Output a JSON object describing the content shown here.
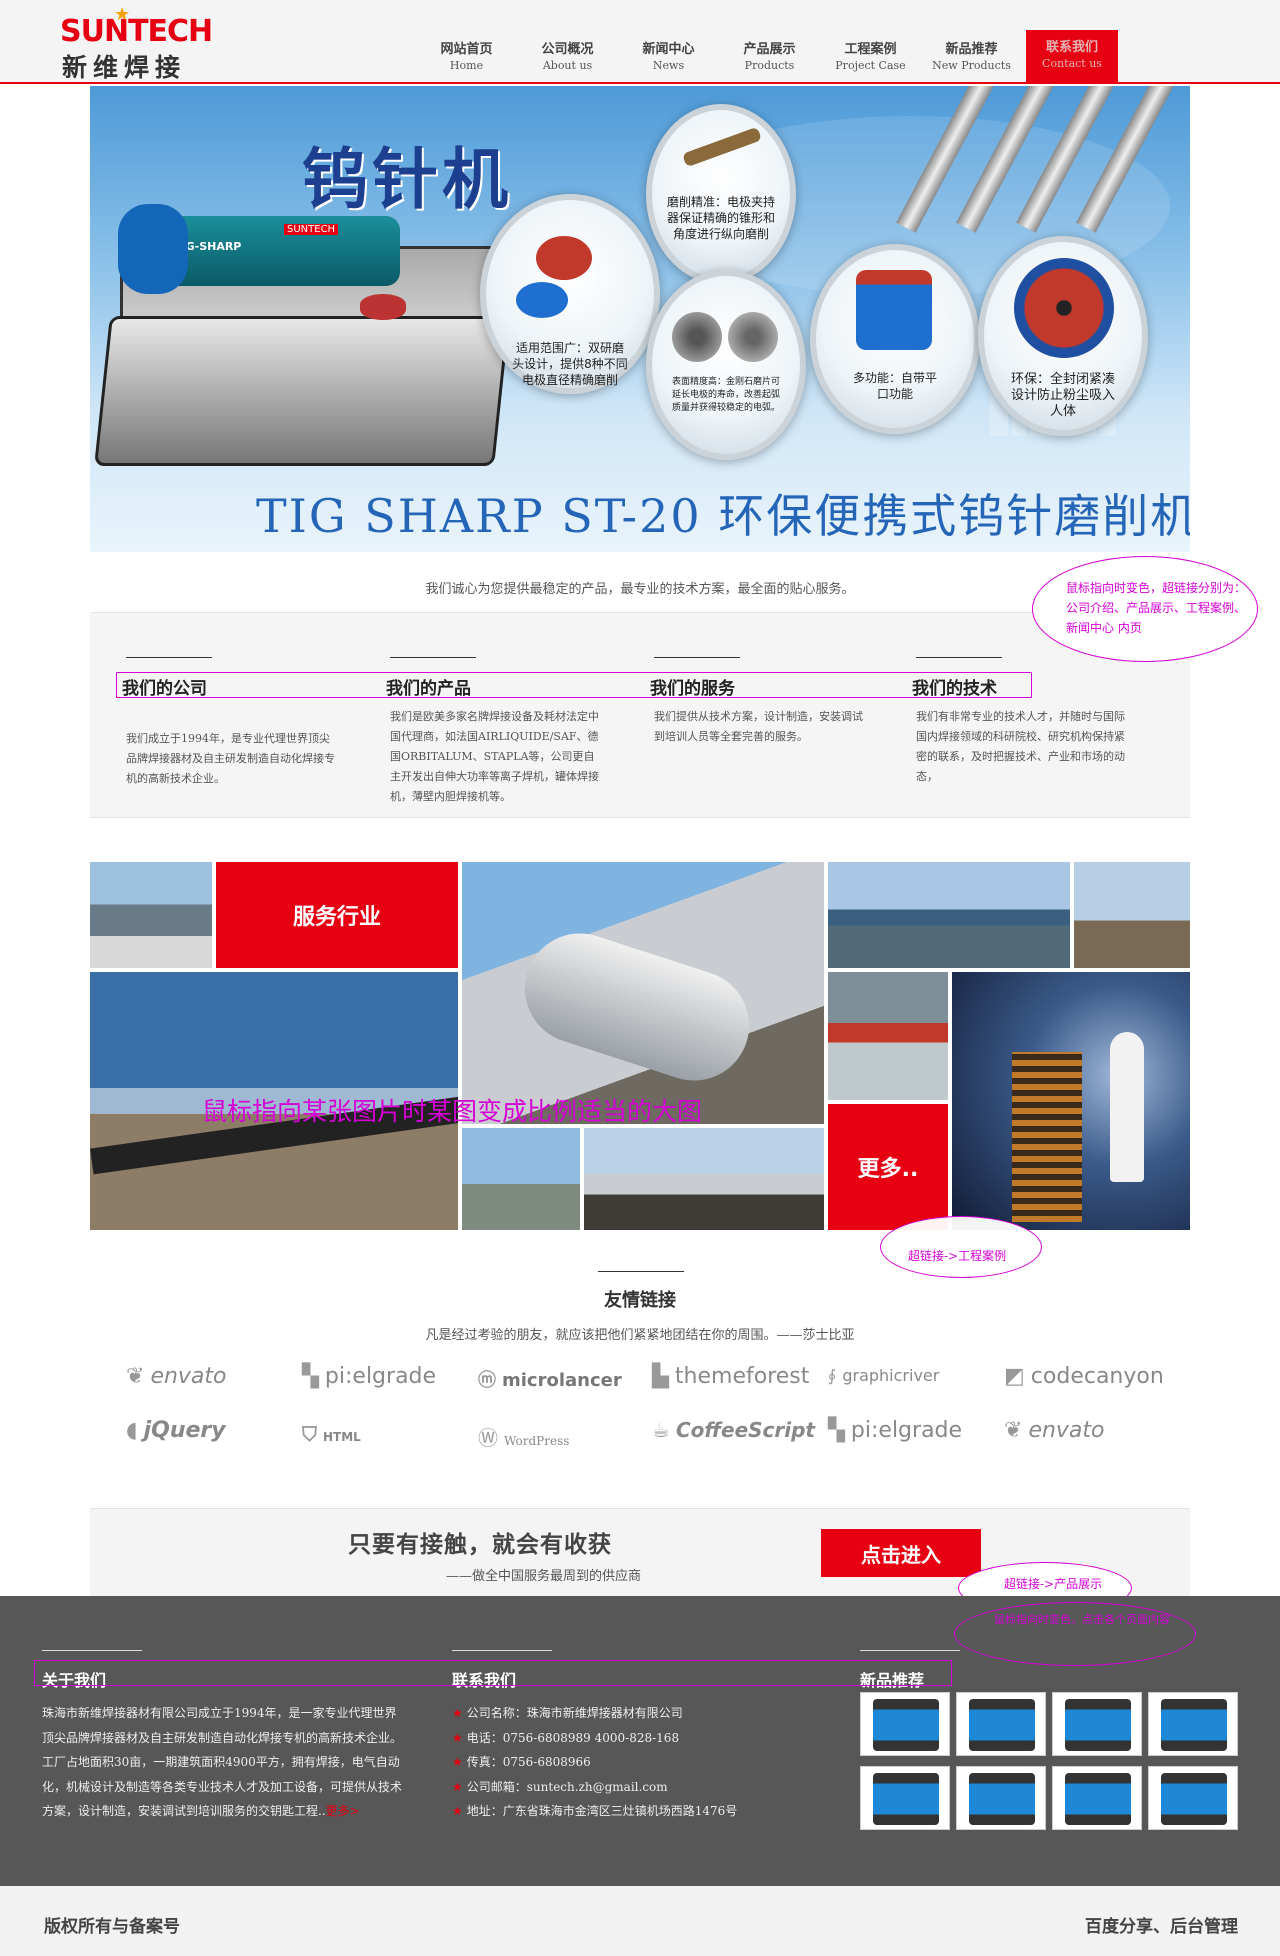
{
  "header": {
    "logo_en": "SUNTECH",
    "logo_cn": "新维焊接",
    "nav": [
      {
        "cn": "网站首页",
        "en": "Home"
      },
      {
        "cn": "公司概况",
        "en": "About us"
      },
      {
        "cn": "新闻中心",
        "en": "News"
      },
      {
        "cn": "产品展示",
        "en": "Products"
      },
      {
        "cn": "工程案例",
        "en": "Project Case"
      },
      {
        "cn": "新品推荐",
        "en": "New Products"
      },
      {
        "cn": "联系我们",
        "en": "Contact us"
      }
    ]
  },
  "banner": {
    "title": "钨针机",
    "subtitle": "TIG SHARP ST-20 环保便携式钨针磨削机",
    "grinder_label": "TIG-SHARP",
    "grinder_brand": "SUNTECH",
    "bubbles": [
      "适用范围广：双研磨头设计，提供8种不同电极直径精确磨削",
      "磨削精准：电极夹持器保证精确的锥形和角度进行纵向磨削",
      "表面精度高：金刚石磨片可延长电极的寿命，改善起弧质量并获得较稳定的电弧。",
      "多功能：自带平口功能",
      "环保：全封闭紧凑设计防止粉尘吸入人体"
    ]
  },
  "intro": "我们诚心为您提供最稳定的产品，最专业的技术方案，最全面的贴心服务。",
  "annotations": {
    "hover_note": "鼠标指向时变色，超链接分别为：公司介绍、产品展示、工程案例、新闻中心 内页",
    "grid_note": "鼠标指向某张图片时某图变成比例适当的大图",
    "more_link_note": "超链接->工程案例",
    "cta_link_note": "超链接->产品展示",
    "footer_note": "鼠标指向时变色，点击各个页面内容"
  },
  "features": [
    {
      "title": "我们的公司",
      "text": "我们成立于1994年，是专业代理世界顶尖品牌焊接器材及自主研发制造自动化焊接专机的高新技术企业。"
    },
    {
      "title": "我们的产品",
      "text": "我们是欧美多家名牌焊接设备及耗材法定中国代理商，如法国AIRLIQUIDE/SAF、德国ORBITALUM、STAPLA等，公司更自主开发出自伸大功率等离子焊机，罐体焊接机，薄壁内胆焊接机等。"
    },
    {
      "title": "我们的服务",
      "text": "我们提供从技术方案，设计制造，安装调试到培训人员等全套完善的服务。"
    },
    {
      "title": "我们的技术",
      "text": "我们有非常专业的技术人才，并随时与国际国内焊接领域的科研院校、研究机构保持紧密的联系，及时把握技术、产业和市场的动态，"
    }
  ],
  "grid": {
    "service_label": "服务行业",
    "more_label": "更多.."
  },
  "friends": {
    "title": "友情链接",
    "subtitle": "凡是经过考验的朋友，就应该把他们紧紧地团结在你的周围。——莎士比亚",
    "links": [
      {
        "name": "envato",
        "icon": "envato-icon"
      },
      {
        "name": "pi:elgrade",
        "icon": "pixelgrade-icon"
      },
      {
        "name": "microlancer",
        "icon": "microlancer-icon"
      },
      {
        "name": "themeforest",
        "icon": "themeforest-icon"
      },
      {
        "name": "graphicriver",
        "icon": "graphicriver-icon"
      },
      {
        "name": "codecanyon",
        "icon": "codecanyon-icon"
      },
      {
        "name": "jQuery",
        "icon": "jquery-icon"
      },
      {
        "name": "HTML",
        "icon": "html5-icon"
      },
      {
        "name": "WordPress",
        "icon": "wordpress-icon"
      },
      {
        "name": "CoffeeScript",
        "icon": "coffeescript-icon"
      },
      {
        "name": "pi:elgrade",
        "icon": "pixelgrade-icon"
      },
      {
        "name": "envato",
        "icon": "envato-icon"
      }
    ]
  },
  "cta": {
    "title": "只要有接触，就会有收获",
    "subtitle": "——做全中国服务最周到的供应商",
    "button": "点击进入"
  },
  "footer": {
    "about_title": "关于我们",
    "about_text": "珠海市新维焊接器材有限公司成立于1994年，是一家专业代理世界顶尖品牌焊接器材及自主研发制造自动化焊接专机的高新技术企业。工厂占地面积30亩，一期建筑面积4900平方，拥有焊接，电气自动化，机械设计及制造等各类专业技术人才及加工设备，可提供从技术方案，设计制造，安装调试到培训服务的交钥匙工程..",
    "about_more": "更多>",
    "contact_title": "联系我们",
    "contact": [
      "公司名称：珠海市新维焊接器材有限公司",
      "电话：0756-6808989 4000-828-168",
      "传真：0756-6808966",
      "公司邮箱：suntech.zh@gmail.com",
      "地址：广东省珠海市金湾区三灶镇机场西路1476号"
    ],
    "new_title": "新品推荐",
    "copyright": "版权所有与备案号",
    "bottom_right": "百度分享、后台管理"
  },
  "colors": {
    "brand_red": "#e60012",
    "annotation": "#d600d6",
    "footer_bg": "#575757"
  }
}
